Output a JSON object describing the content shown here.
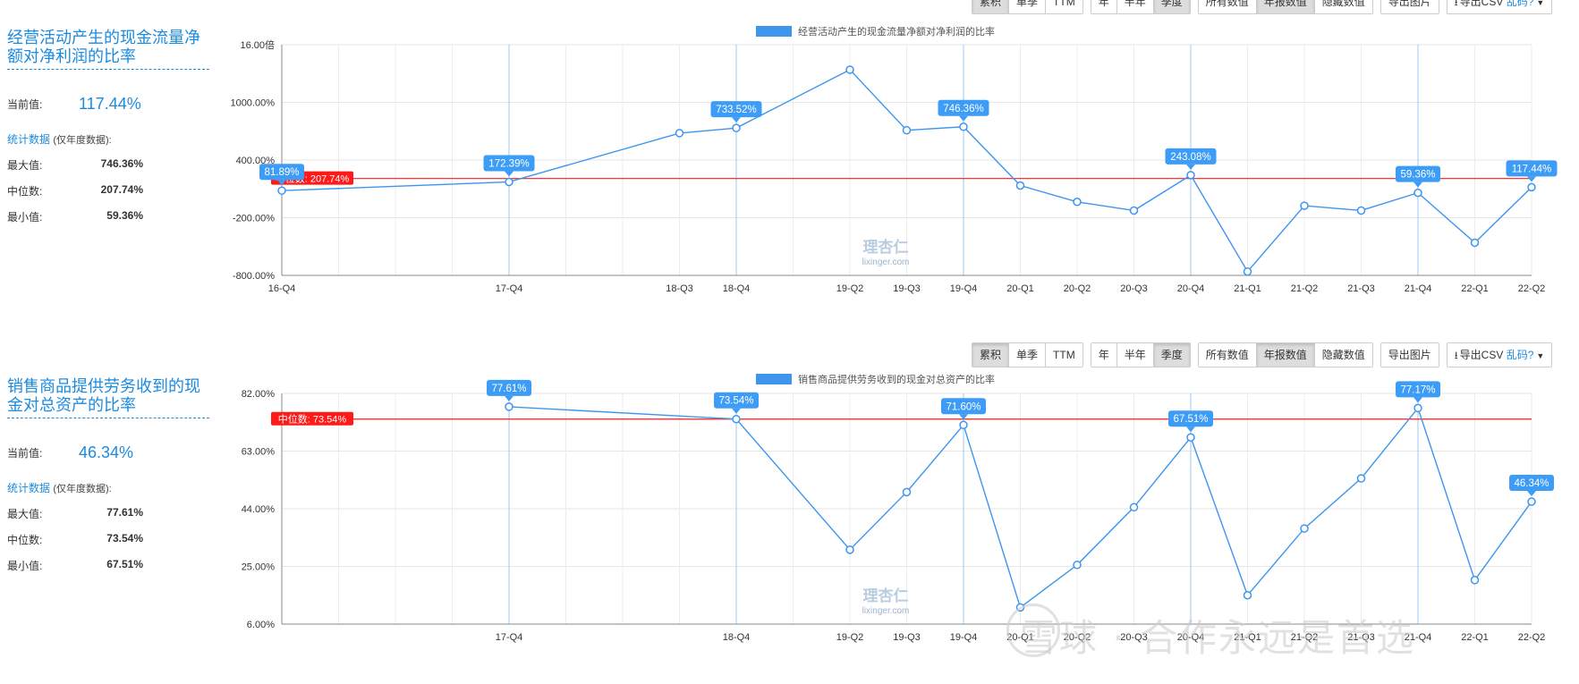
{
  "colors": {
    "accent": "#1b8be0",
    "line": "#3d95ee",
    "median": "#ff1a1a",
    "label_bg": "#3d9cf5"
  },
  "toolbar": {
    "group1": [
      "累积",
      "单季",
      "TTM"
    ],
    "group1_active": 0,
    "group2": [
      "年",
      "半年",
      "季度"
    ],
    "group2_active": 2,
    "group3": [
      "所有数值",
      "年报数值",
      "隐藏数值"
    ],
    "group3_active": 1,
    "export_image": "导出图片",
    "export_csv": "导出CSV",
    "garbled": "乱码?",
    "download_icon": "download-icon",
    "caret_icon": "caret-down-icon"
  },
  "charts": [
    {
      "title": "经营活动产生的现金流量净额对净利润的比率",
      "current_label": "当前值:",
      "current_value": "117.44%",
      "stats_label": "统计数据",
      "stats_note": "(仅年度数据):",
      "max_label": "最大值:",
      "max_value": "746.36%",
      "median_label": "中位数:",
      "median_value": "207.74%",
      "min_label": "最小值:",
      "min_value": "59.36%"
    },
    {
      "title": "销售商品提供劳务收到的现金对总资产的比率",
      "current_label": "当前值:",
      "current_value": "46.34%",
      "stats_label": "统计数据",
      "stats_note": "(仅年度数据):",
      "max_label": "最大值:",
      "max_value": "77.61%",
      "median_label": "中位数:",
      "median_value": "73.54%",
      "min_label": "最小值:",
      "min_value": "67.51%"
    }
  ],
  "chart_data": [
    {
      "type": "line",
      "legend": "经营活动产生的现金流量净额对净利润的比率",
      "yticks": [
        "16.00倍",
        "1000.00%",
        "400.00%",
        "-200.00%",
        "-800.00%"
      ],
      "ylim": [
        -800,
        1600
      ],
      "categories": [
        "16-Q4",
        "17-Q4",
        "18-Q3",
        "18-Q4",
        "19-Q2",
        "19-Q3",
        "19-Q4",
        "20-Q1",
        "20-Q2",
        "20-Q3",
        "20-Q4",
        "21-Q1",
        "21-Q2",
        "21-Q3",
        "21-Q4",
        "22-Q1",
        "22-Q2"
      ],
      "cat_pos": [
        0,
        4,
        7,
        8,
        10,
        11,
        12,
        13,
        14,
        15,
        16,
        17,
        18,
        19,
        20,
        21,
        22
      ],
      "annual_index": [
        0,
        1,
        3,
        6,
        10,
        14
      ],
      "values": [
        81.89,
        172.39,
        680,
        733.52,
        1340,
        710,
        746.36,
        135,
        -35,
        -125,
        243.08,
        -760,
        -75,
        -125,
        59.36,
        -460,
        117.44
      ],
      "labels": {
        "0": "81.89%",
        "1": "172.39%",
        "3": "733.52%",
        "6": "746.36%",
        "10": "243.08%",
        "14": "59.36%",
        "16": "117.44%"
      },
      "median": 207.74,
      "median_label": "中位数: 207.74%",
      "grid": true
    },
    {
      "type": "line",
      "legend": "销售商品提供劳务收到的现金对总资产的比率",
      "yticks": [
        "82.00%",
        "63.00%",
        "44.00%",
        "25.00%",
        "6.00%"
      ],
      "ylim": [
        6,
        82
      ],
      "categories": [
        "17-Q4",
        "18-Q4",
        "19-Q2",
        "19-Q3",
        "19-Q4",
        "20-Q1",
        "20-Q2",
        "20-Q3",
        "20-Q4",
        "21-Q1",
        "21-Q2",
        "21-Q3",
        "21-Q4",
        "22-Q1",
        "22-Q2"
      ],
      "cat_pos": [
        4,
        8,
        10,
        11,
        12,
        13,
        14,
        15,
        16,
        17,
        18,
        19,
        20,
        21,
        22
      ],
      "annual_index": [
        0,
        1,
        4,
        8,
        12
      ],
      "values": [
        77.61,
        73.54,
        30.5,
        49.5,
        71.6,
        11.5,
        25.5,
        44.5,
        67.51,
        15.5,
        37.5,
        54,
        77.17,
        20.5,
        46.34
      ],
      "labels": {
        "0": "77.61%",
        "1": "73.54%",
        "4": "71.60%",
        "8": "67.51%",
        "12": "77.17%",
        "14": "46.34%"
      },
      "median": 73.54,
      "median_label": "中位数: 73.54%",
      "grid": true
    }
  ],
  "watermarks": {
    "site_cn": "理杏仁",
    "site_url": "lixinger.com",
    "bottom": "雪球 · 合作永远是首选"
  }
}
